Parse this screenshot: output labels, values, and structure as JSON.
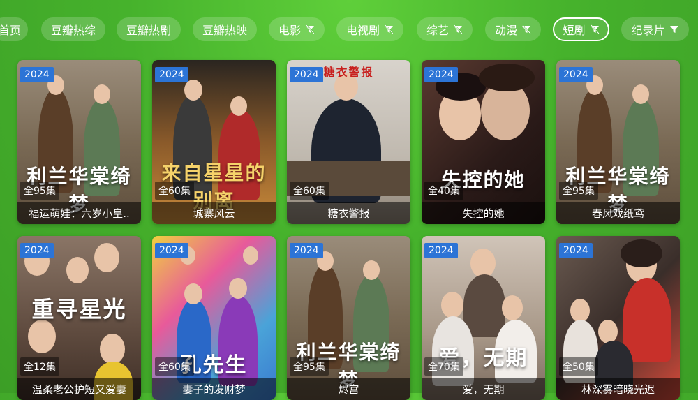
{
  "tabs": [
    {
      "label": "首页"
    },
    {
      "label": "豆瓣热综"
    },
    {
      "label": "豆瓣热剧"
    },
    {
      "label": "豆瓣热映"
    },
    {
      "label": "电影",
      "icon": "filter-off-icon"
    },
    {
      "label": "电视剧",
      "icon": "filter-off-icon"
    },
    {
      "label": "综艺",
      "icon": "filter-off-icon"
    },
    {
      "label": "动漫",
      "icon": "filter-off-icon"
    },
    {
      "label": "短剧",
      "icon": "filter-off-icon",
      "active": true
    },
    {
      "label": "纪录片",
      "icon": "filter-icon"
    }
  ],
  "cards": [
    {
      "year": "2024",
      "episodes": "全95集",
      "title": "福运萌娃：六岁小皇..",
      "poster_color": "#8a7660",
      "art": "利兰华棠绮梦"
    },
    {
      "year": "2024",
      "episodes": "全60集",
      "title": "城寨风云",
      "poster_color": "#6b4a2a",
      "art": "来自星星的别离"
    },
    {
      "year": "2024",
      "episodes": "全60集",
      "title": "糖衣警报",
      "poster_color": "#c9c3bb",
      "art": "糖衣警报"
    },
    {
      "year": "2024",
      "episodes": "全40集",
      "title": "失控的她",
      "poster_color": "#3a2a25",
      "art": "失控的她"
    },
    {
      "year": "2024",
      "episodes": "全95集",
      "title": "春风戏纸鸢",
      "poster_color": "#8a7660",
      "art": "利兰华棠绮梦"
    },
    {
      "year": "2024",
      "episodes": "全12集",
      "title": "温柔老公护短又爱妻",
      "poster_color": "#6e5848",
      "art": "重寻星光"
    },
    {
      "year": "2024",
      "episodes": "全60集",
      "title": "妻子的发财梦",
      "poster_color": "#4aa3d8",
      "art": "孔先生"
    },
    {
      "year": "2024",
      "episodes": "全95集",
      "title": "烬宫",
      "poster_color": "#8a7660",
      "art": "利兰华棠绮梦"
    },
    {
      "year": "2024",
      "episodes": "全70集",
      "title": "爱，无期",
      "poster_color": "#b9a89a",
      "art": "爱，无期"
    },
    {
      "year": "2024",
      "episodes": "全50集",
      "title": "林深雾暗晓光迟",
      "poster_color": "#4a3a35",
      "art": ""
    }
  ]
}
